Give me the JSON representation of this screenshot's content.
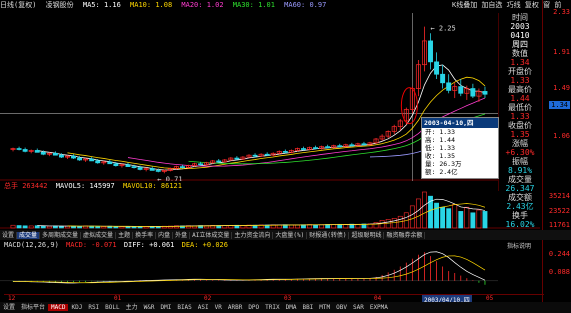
{
  "colors": {
    "up": "#ff2a2a",
    "down": "#29d5e6",
    "ma5": "#ffffff",
    "ma10": "#ffd800",
    "ma20": "#ff3dd0",
    "ma30": "#2ee02e",
    "ma60": "#9b9bff",
    "vol": "#ffd800",
    "axis": "#990000"
  },
  "topbar": {
    "period": "日线(复权)",
    "stock": "凌钢股份",
    "ma5": "MA5: 1.16",
    "ma10": "MA10: 1.08",
    "ma20": "MA20: 1.02",
    "ma30": "MA30: 1.01",
    "ma60": "MA60: 0.97"
  },
  "right_tools": {
    "a": "K线叠加",
    "b": "加自选",
    "c": "巧线",
    "d": "复权",
    "e": "窗",
    "f": "前"
  },
  "price_axis": [
    "2.33",
    "1.91",
    "1.49",
    "1.34",
    "1.06"
  ],
  "volume_axis": [
    "35214",
    "23522",
    "11761"
  ],
  "macd_axis": [
    "0.244",
    "0.088"
  ],
  "chart_labels": {
    "high": "2.25",
    "low": "0.71"
  },
  "info_panel": {
    "time_label": "时间",
    "date_year": "2003",
    "date_md": "0410",
    "weekday": "周四",
    "value_label": "数值",
    "value": "1.34",
    "open_label": "开盘价",
    "open": "1.33",
    "high_label": "最高价",
    "high": "1.44",
    "low_label": "最低价",
    "low": "1.33",
    "close_label": "收盘价",
    "close": "1.35",
    "change_label": "涨幅",
    "change": "+6.30%",
    "amp_label": "振幅",
    "amp": "8.91%",
    "vol_label": "成交量",
    "vol": "26.347",
    "amt_label": "成交额",
    "amt": "2.43亿",
    "turn_label": "换手",
    "turn": "16.02%"
  },
  "tooltip": {
    "date": "2003-04-10,四",
    "lines": [
      "开: 1.33",
      "高: 1.44",
      "低: 1.33",
      "收: 1.35",
      "量: 26.3万",
      "额: 2.4亿"
    ]
  },
  "volume_header": {
    "label": "总手",
    "total": "263442",
    "ma5": "MAVOL5: 145997",
    "ma10": "MAVOL10: 86121"
  },
  "tabs": [
    "设置",
    "成交量",
    "多周期成交量",
    "虚拟成交量",
    "主题",
    "换手率",
    "内盘",
    "外盘",
    "AI立体成交量",
    "主力资金流向",
    "大盘量(%)",
    "财报通(转债)",
    "超级聪明线",
    "融资融券余额"
  ],
  "macd_header": {
    "label": "MACD(12,26,9)",
    "macd": "MACD: -0.071",
    "diff": "DIFF: +0.061",
    "dea": "DEA: +0.026"
  },
  "macd_side": "指标说明",
  "dates": [
    "12",
    "01",
    "02",
    "03",
    "04",
    "2003/04/10,四",
    "05"
  ],
  "bottombar": [
    "设置",
    "指标平台",
    "MACD",
    "KDJ",
    "RSI",
    "BOLL",
    "主力",
    "W&R",
    "DMI",
    "BIAS",
    "ASI",
    "VR",
    "ARBR",
    "DPO",
    "TRIX",
    "DMA",
    "BBI",
    "MTM",
    "OBV",
    "SAR",
    "EXPMA"
  ],
  "bottombar_active": "MACD",
  "active_tab": "成交量",
  "candles": [
    [
      0.96,
      0.98,
      0.94,
      0.97
    ],
    [
      0.97,
      0.99,
      0.95,
      0.96
    ],
    [
      0.96,
      0.98,
      0.93,
      0.94
    ],
    [
      0.94,
      0.96,
      0.92,
      0.95
    ],
    [
      0.95,
      0.97,
      0.93,
      0.93
    ],
    [
      0.93,
      0.95,
      0.9,
      0.91
    ],
    [
      0.91,
      0.93,
      0.89,
      0.92
    ],
    [
      0.92,
      0.94,
      0.9,
      0.9
    ],
    [
      0.9,
      0.92,
      0.87,
      0.88
    ],
    [
      0.88,
      0.9,
      0.86,
      0.89
    ],
    [
      0.89,
      0.91,
      0.86,
      0.87
    ],
    [
      0.87,
      0.89,
      0.84,
      0.85
    ],
    [
      0.85,
      0.87,
      0.83,
      0.86
    ],
    [
      0.86,
      0.88,
      0.84,
      0.84
    ],
    [
      0.84,
      0.86,
      0.81,
      0.82
    ],
    [
      0.82,
      0.84,
      0.8,
      0.83
    ],
    [
      0.83,
      0.85,
      0.81,
      0.81
    ],
    [
      0.81,
      0.83,
      0.78,
      0.79
    ],
    [
      0.79,
      0.81,
      0.77,
      0.8
    ],
    [
      0.8,
      0.82,
      0.78,
      0.78
    ],
    [
      0.78,
      0.8,
      0.76,
      0.77
    ],
    [
      0.77,
      0.79,
      0.74,
      0.75
    ],
    [
      0.75,
      0.77,
      0.73,
      0.76
    ],
    [
      0.76,
      0.78,
      0.74,
      0.74
    ],
    [
      0.74,
      0.76,
      0.72,
      0.73
    ],
    [
      0.73,
      0.75,
      0.71,
      0.74
    ],
    [
      0.74,
      0.77,
      0.73,
      0.76
    ],
    [
      0.76,
      0.79,
      0.75,
      0.78
    ],
    [
      0.78,
      0.8,
      0.76,
      0.77
    ],
    [
      0.77,
      0.8,
      0.76,
      0.79
    ],
    [
      0.79,
      0.82,
      0.78,
      0.81
    ],
    [
      0.81,
      0.83,
      0.79,
      0.8
    ],
    [
      0.8,
      0.83,
      0.79,
      0.82
    ],
    [
      0.82,
      0.85,
      0.81,
      0.84
    ],
    [
      0.84,
      0.86,
      0.82,
      0.83
    ],
    [
      0.83,
      0.86,
      0.82,
      0.85
    ],
    [
      0.85,
      0.88,
      0.84,
      0.87
    ],
    [
      0.87,
      0.89,
      0.85,
      0.86
    ],
    [
      0.86,
      0.89,
      0.85,
      0.88
    ],
    [
      0.88,
      0.91,
      0.87,
      0.9
    ],
    [
      0.9,
      0.92,
      0.88,
      0.89
    ],
    [
      0.89,
      0.92,
      0.88,
      0.91
    ],
    [
      0.91,
      0.93,
      0.89,
      0.9
    ],
    [
      0.9,
      0.93,
      0.89,
      0.92
    ],
    [
      0.92,
      0.95,
      0.91,
      0.94
    ],
    [
      0.94,
      0.96,
      0.92,
      0.93
    ],
    [
      0.93,
      0.96,
      0.92,
      0.95
    ],
    [
      0.95,
      0.98,
      0.94,
      0.97
    ],
    [
      0.97,
      0.99,
      0.95,
      0.96
    ],
    [
      0.96,
      0.99,
      0.95,
      0.98
    ],
    [
      0.98,
      1.0,
      0.96,
      0.97
    ],
    [
      0.97,
      1.0,
      0.96,
      0.99
    ],
    [
      0.99,
      1.01,
      0.97,
      0.98
    ],
    [
      0.98,
      1.01,
      0.97,
      1.0
    ],
    [
      1.0,
      1.02,
      0.98,
      0.99
    ],
    [
      0.99,
      1.02,
      0.98,
      1.01
    ],
    [
      1.01,
      1.03,
      0.99,
      1.0
    ],
    [
      1.0,
      1.03,
      0.99,
      1.02
    ],
    [
      1.02,
      1.04,
      1.0,
      1.01
    ],
    [
      1.01,
      1.04,
      1.0,
      1.03
    ],
    [
      1.03,
      1.08,
      1.02,
      1.07
    ],
    [
      1.07,
      1.12,
      1.05,
      1.1
    ],
    [
      1.1,
      1.16,
      1.08,
      1.15
    ],
    [
      1.15,
      1.22,
      1.12,
      1.2
    ],
    [
      1.2,
      1.28,
      1.16,
      1.26
    ],
    [
      1.26,
      1.4,
      1.22,
      1.38
    ],
    [
      1.38,
      1.62,
      1.34,
      1.6
    ],
    [
      1.6,
      1.9,
      1.52,
      1.85
    ],
    [
      1.85,
      2.25,
      1.78,
      2.1
    ],
    [
      2.1,
      2.18,
      1.8,
      1.88
    ],
    [
      1.88,
      1.98,
      1.7,
      1.75
    ],
    [
      1.75,
      1.85,
      1.6,
      1.66
    ],
    [
      1.66,
      1.75,
      1.55,
      1.58
    ],
    [
      1.58,
      1.66,
      1.5,
      1.62
    ],
    [
      1.62,
      1.7,
      1.52,
      1.55
    ],
    [
      1.55,
      1.63,
      1.48,
      1.6
    ],
    [
      1.6,
      1.65,
      1.5,
      1.52
    ],
    [
      1.52,
      1.6,
      1.46,
      1.57
    ],
    [
      1.57,
      1.62,
      1.5,
      1.54
    ]
  ],
  "volumes": [
    20,
    18,
    16,
    15,
    17,
    14,
    13,
    15,
    12,
    14,
    13,
    12,
    15,
    13,
    12,
    11,
    13,
    12,
    11,
    12,
    10,
    11,
    12,
    10,
    11,
    13,
    14,
    16,
    15,
    17,
    16,
    18,
    17,
    19,
    18,
    17,
    18,
    20,
    19,
    21,
    20,
    22,
    21,
    23,
    22,
    24,
    23,
    22,
    24,
    25,
    23,
    24,
    26,
    25,
    27,
    26,
    28,
    27,
    29,
    30,
    40,
    55,
    62,
    70,
    85,
    110,
    160,
    210,
    260,
    230,
    180,
    150,
    140,
    170,
    120,
    150,
    110,
    130,
    120
  ],
  "macd_bars": [
    -1,
    -1,
    -1,
    -2,
    -2,
    -2,
    -3,
    -3,
    -3,
    -3,
    -2,
    -2,
    -2,
    -1,
    -1,
    -1,
    -1,
    -1,
    0,
    0,
    0,
    1,
    1,
    1,
    1,
    1,
    2,
    2,
    2,
    2,
    2,
    2,
    1,
    1,
    1,
    1,
    1,
    1,
    1,
    2,
    2,
    2,
    2,
    2,
    2,
    2,
    2,
    3,
    3,
    3,
    3,
    3,
    3,
    3,
    3,
    3,
    3,
    3,
    3,
    4,
    6,
    9,
    13,
    17,
    22,
    28,
    34,
    40,
    44,
    38,
    30,
    22,
    15,
    12,
    8,
    4,
    1,
    -3,
    -6
  ]
}
